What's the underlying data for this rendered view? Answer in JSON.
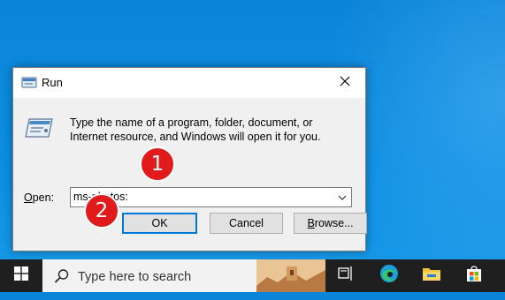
{
  "dialog": {
    "title": "Run",
    "description": "Type the name of a program, folder, document, or Internet resource, and Windows will open it for you.",
    "open_label_prefix": "O",
    "open_label_rest": "pen:",
    "open_value": "ms-photos:",
    "ok_label": "OK",
    "cancel_label": "Cancel",
    "browse_label_prefix": "B",
    "browse_label_rest": "rowse..."
  },
  "badges": {
    "step1": "1",
    "step2": "2"
  },
  "taskbar": {
    "search_placeholder": "Type here to search"
  },
  "colors": {
    "accent": "#0078d7",
    "badge": "#e11b1b",
    "taskbar": "#1f1f1f"
  },
  "icons": [
    "run-program-icon",
    "close-icon",
    "combo-dropdown-icon",
    "windows-start-icon",
    "search-icon",
    "task-view-icon",
    "edge-icon",
    "file-explorer-icon",
    "store-icon"
  ]
}
